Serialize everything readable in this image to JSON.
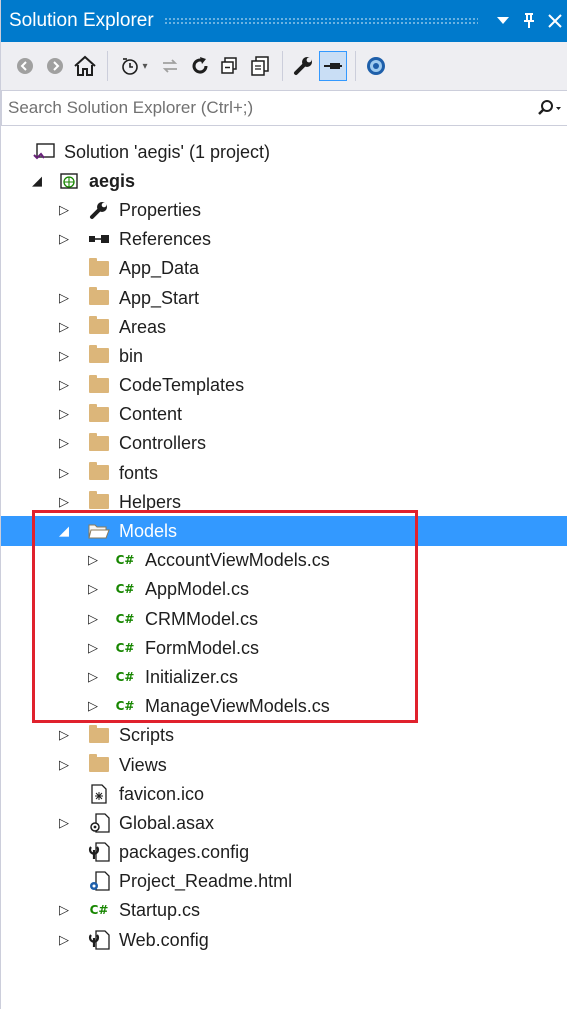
{
  "window": {
    "title": "Solution Explorer",
    "title_buttons": [
      "dropdown-arrow",
      "pin",
      "close"
    ]
  },
  "toolbar": {
    "icons": [
      "back-icon",
      "forward-icon",
      "home-icon",
      "pending-changes-icon",
      "sync-icon",
      "refresh-icon",
      "collapse-all-icon",
      "show-all-files-icon",
      "properties-icon",
      "preview-selected-icon",
      "view-in-browser-icon"
    ]
  },
  "search": {
    "placeholder": "Search Solution Explorer (Ctrl+;)"
  },
  "tree": {
    "solution_label": "Solution 'aegis' (1 project)",
    "project_label": "aegis",
    "items": [
      {
        "label": "Properties"
      },
      {
        "label": "References"
      },
      {
        "label": "App_Data"
      },
      {
        "label": "App_Start"
      },
      {
        "label": "Areas"
      },
      {
        "label": "bin"
      },
      {
        "label": "CodeTemplates"
      },
      {
        "label": "Content"
      },
      {
        "label": "Controllers"
      },
      {
        "label": "fonts"
      },
      {
        "label": "Helpers"
      },
      {
        "label": "Models"
      },
      {
        "label": "AccountViewModels.cs"
      },
      {
        "label": "AppModel.cs"
      },
      {
        "label": "CRMModel.cs"
      },
      {
        "label": "FormModel.cs"
      },
      {
        "label": "Initializer.cs"
      },
      {
        "label": "ManageViewModels.cs"
      },
      {
        "label": "Scripts"
      },
      {
        "label": "Views"
      },
      {
        "label": "favicon.ico"
      },
      {
        "label": "Global.asax"
      },
      {
        "label": "packages.config"
      },
      {
        "label": "Project_Readme.html"
      },
      {
        "label": "Startup.cs"
      },
      {
        "label": "Web.config"
      }
    ],
    "csharp_glyph": "C#",
    "selected_item": "Models"
  },
  "colors": {
    "accent": "#007acc",
    "selection": "#3399ff",
    "highlight": "#e0212d",
    "folder": "#dcb67a",
    "csharp": "#178600"
  }
}
